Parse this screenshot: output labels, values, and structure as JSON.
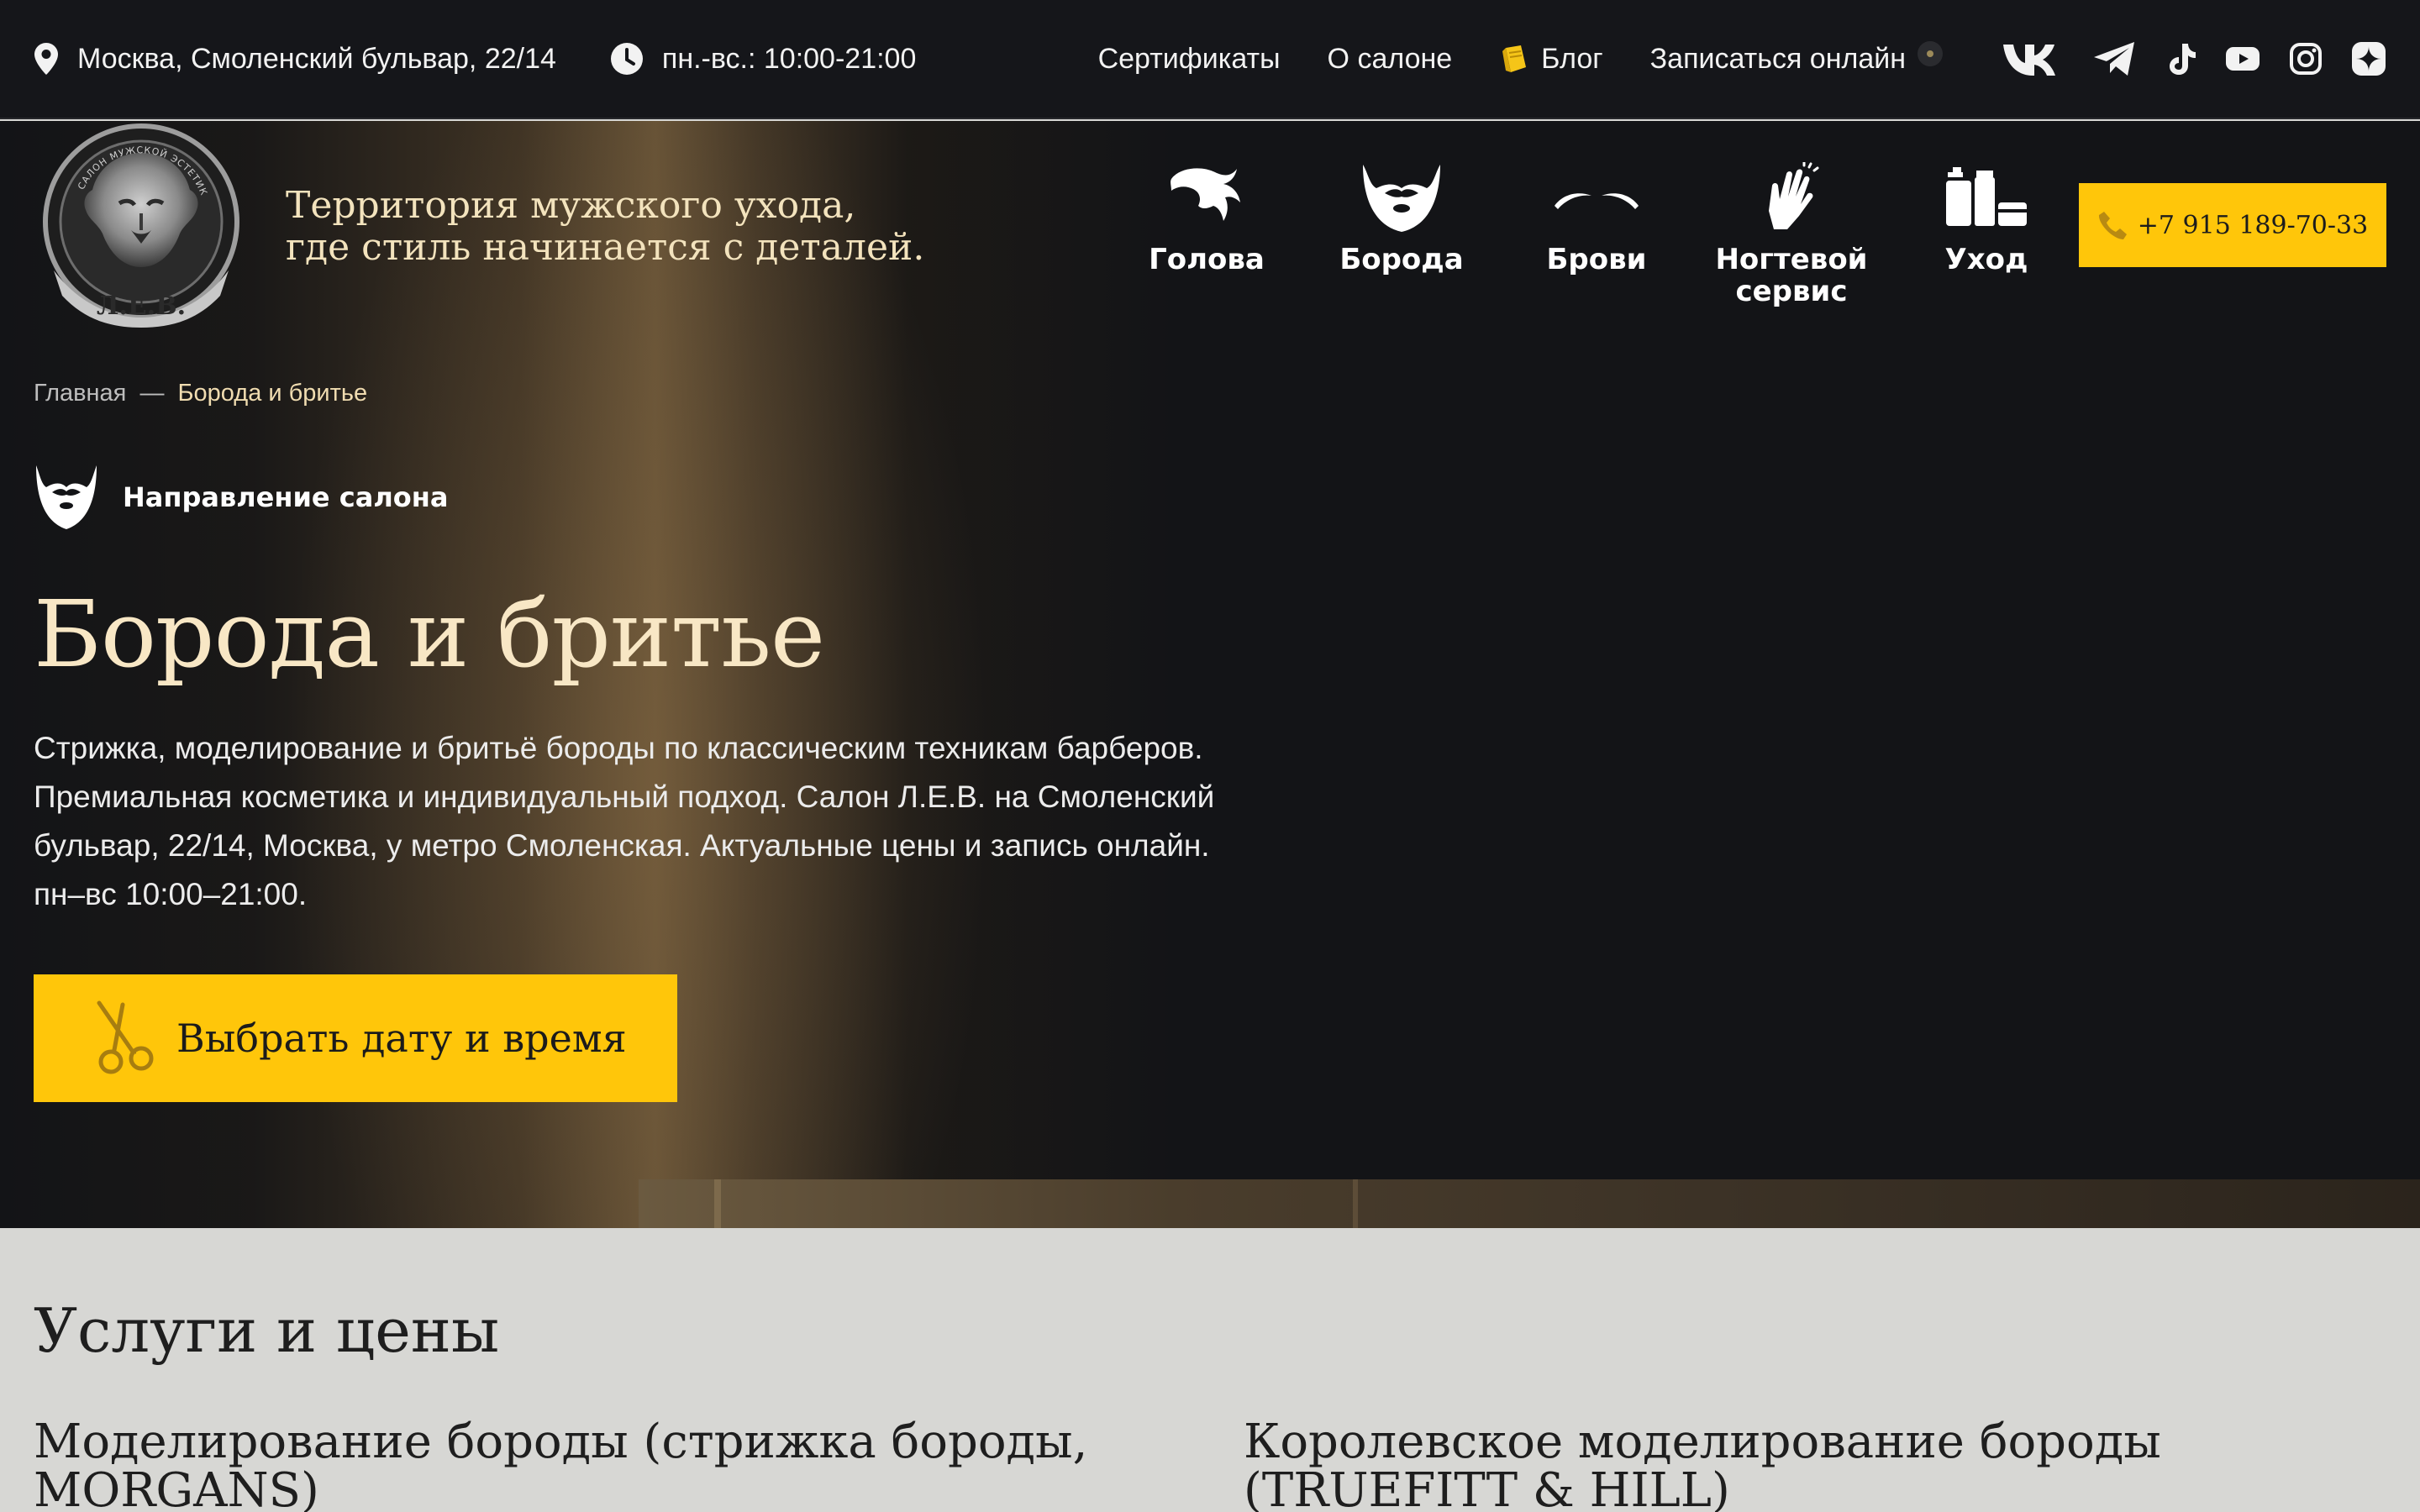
{
  "topbar": {
    "address": "Москва, Смоленский бульвар, 22/14",
    "hours": "пн.-вс.: 10:00-21:00",
    "nav": {
      "certificates": "Сертификаты",
      "about": "О салоне",
      "blog": "Блог",
      "book_online": "Записаться онлайн"
    },
    "socials": [
      "vk-icon",
      "telegram-icon",
      "tiktok-icon",
      "youtube-icon",
      "instagram-icon",
      "yandex-zen-icon"
    ]
  },
  "header": {
    "logo_text": "Л.Е.В.",
    "logo_ring_text": "САЛОН МУЖСКОЙ ЭСТЕТИКИ",
    "tagline_line1": "Территория мужского ухода,",
    "tagline_line2": "где стиль начинается с деталей.",
    "categories": [
      {
        "label": "Голова",
        "icon": "hair-icon"
      },
      {
        "label": "Борода",
        "icon": "beard-icon"
      },
      {
        "label": "Брови",
        "icon": "eyebrows-icon"
      },
      {
        "label": "Ногтевой сервис",
        "icon": "hands-icon"
      },
      {
        "label": "Уход",
        "icon": "cosmetics-icon"
      }
    ],
    "phone": "+7 915 189-70-33"
  },
  "breadcrumb": {
    "home": "Главная",
    "separator": "—",
    "current": "Борода и бритье"
  },
  "hero": {
    "direction_label": "Направление салона",
    "title": "Борода и бритье",
    "description": "Стрижка, моделирование и бритьё бороды по классическим техникам барберов. Премиальная косметика и индивидуальный подход. Салон Л.Е.В. на Смоленский бульвар, 22/14, Москва, у метро Смоленская. Актуальные цены и запись онлайн. пн–вс 10:00–21:00.",
    "cta": "Выбрать дату и время"
  },
  "services": {
    "heading": "Услуги и цены",
    "items": [
      {
        "title": "Моделирование бороды (стрижка бороды, MORGANS)"
      },
      {
        "title": "Королевское моделирование бороды (TRUEFITT & HILL)"
      }
    ]
  },
  "colors": {
    "accent": "#ffc60a",
    "background_dark": "#131417",
    "title_cream": "#f8e7c5",
    "section_gray": "#d7d7d4"
  }
}
